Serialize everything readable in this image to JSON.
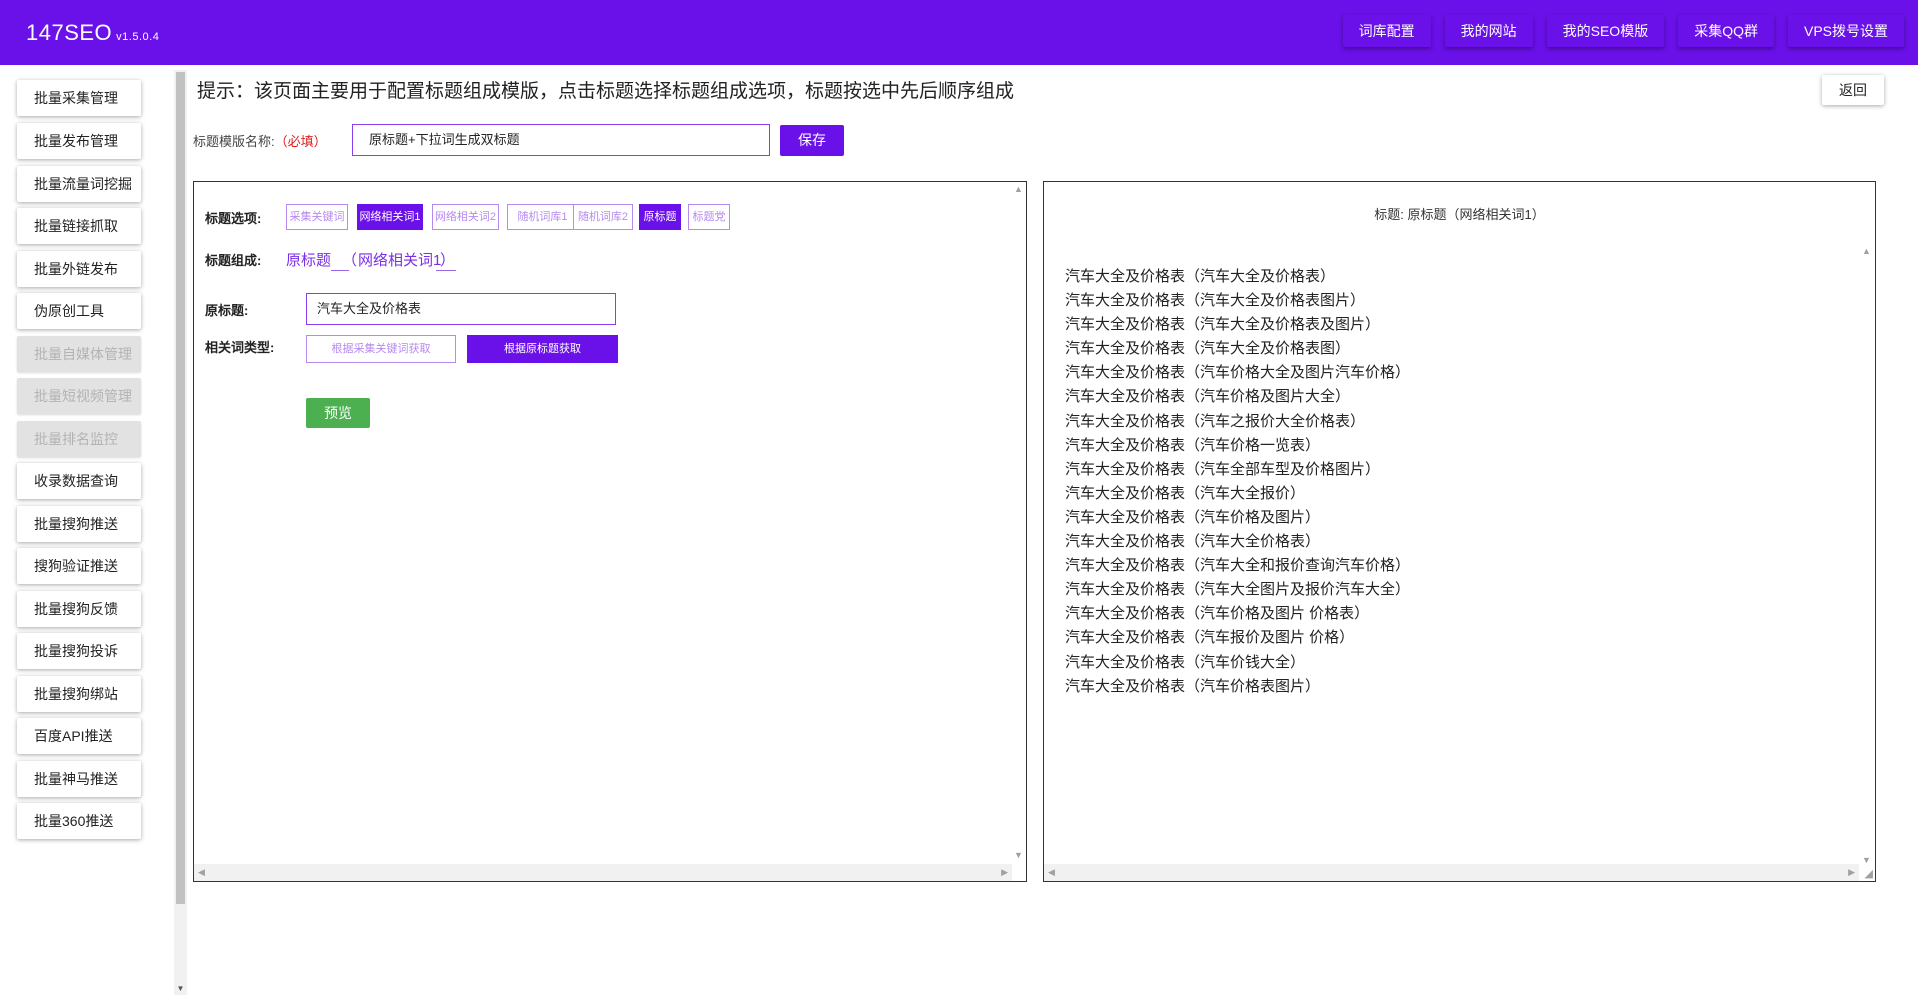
{
  "header": {
    "brand": "147SEO",
    "version": "v1.5.0.4",
    "nav": [
      "词库配置",
      "我的网站",
      "我的SEO模版",
      "采集QQ群",
      "VPS拨号设置"
    ]
  },
  "sidebar": {
    "items": [
      {
        "label": "批量采集管理",
        "disabled": false
      },
      {
        "label": "批量发布管理",
        "disabled": false
      },
      {
        "label": "批量流量词挖掘",
        "disabled": false
      },
      {
        "label": "批量链接抓取",
        "disabled": false
      },
      {
        "label": "批量外链发布",
        "disabled": false
      },
      {
        "label": "伪原创工具",
        "disabled": false
      },
      {
        "label": "批量自媒体管理",
        "disabled": true
      },
      {
        "label": "批量短视频管理",
        "disabled": true
      },
      {
        "label": "批量排名监控",
        "disabled": true
      },
      {
        "label": "收录数据查询",
        "disabled": false
      },
      {
        "label": "批量搜狗推送",
        "disabled": false
      },
      {
        "label": "搜狗验证推送",
        "disabled": false
      },
      {
        "label": "批量搜狗反馈",
        "disabled": false
      },
      {
        "label": "批量搜狗投诉",
        "disabled": false
      },
      {
        "label": "批量搜狗绑站",
        "disabled": false
      },
      {
        "label": "百度API推送",
        "disabled": false
      },
      {
        "label": "批量神马推送",
        "disabled": false
      },
      {
        "label": "批量360推送",
        "disabled": false
      }
    ]
  },
  "main": {
    "hint": "提示：该页面主要用于配置标题组成模版，点击标题选择标题组成选项，标题按选中先后顺序组成",
    "back_label": "返回",
    "name_label": "标题模版名称:",
    "required_label": "（必填）",
    "name_value": "原标题+下拉词生成双标题",
    "save_label": "保存"
  },
  "left_panel": {
    "options_label": "标题选项:",
    "options": [
      {
        "label": "采集关键词",
        "active": false
      },
      {
        "label": "网络相关词1",
        "active": true
      },
      {
        "label": "网络相关词2",
        "active": false
      },
      {
        "label": "随机词库1",
        "active": false
      },
      {
        "label": "随机词库2",
        "active": false
      },
      {
        "label": "原标题",
        "active": true
      },
      {
        "label": "标题党",
        "active": false
      }
    ],
    "composition_label": "标题组成:",
    "composition": [
      "原标题",
      "（",
      "网络相关词1",
      "）"
    ],
    "original_label": "原标题:",
    "original_value": "汽车大全及价格表",
    "related_type_label": "相关词类型:",
    "related_outline": "根据采集关键词获取",
    "related_solid": "根据原标题获取",
    "preview_label": "预览"
  },
  "right_panel": {
    "title": "标题:  原标题（网络相关词1）",
    "results": [
      "汽车大全及价格表（汽车大全及价格表）",
      "汽车大全及价格表（汽车大全及价格表图片）",
      "汽车大全及价格表（汽车大全及价格表及图片）",
      "汽车大全及价格表（汽车大全及价格表图）",
      "汽车大全及价格表（汽车价格大全及图片汽车价格）",
      "汽车大全及价格表（汽车价格及图片大全）",
      "汽车大全及价格表（汽车之报价大全价格表）",
      "汽车大全及价格表（汽车价格一览表）",
      "汽车大全及价格表（汽车全部车型及价格图片）",
      "汽车大全及价格表（汽车大全报价）",
      "汽车大全及价格表（汽车价格及图片）",
      "汽车大全及价格表（汽车大全价格表）",
      "汽车大全及价格表（汽车大全和报价查询汽车价格）",
      "汽车大全及价格表（汽车大全图片及报价汽车大全）",
      "汽车大全及价格表（汽车价格及图片 价格表）",
      "汽车大全及价格表（汽车报价及图片 价格）",
      "汽车大全及价格表（汽车价钱大全）",
      "汽车大全及价格表（汽车价格表图片）"
    ]
  }
}
